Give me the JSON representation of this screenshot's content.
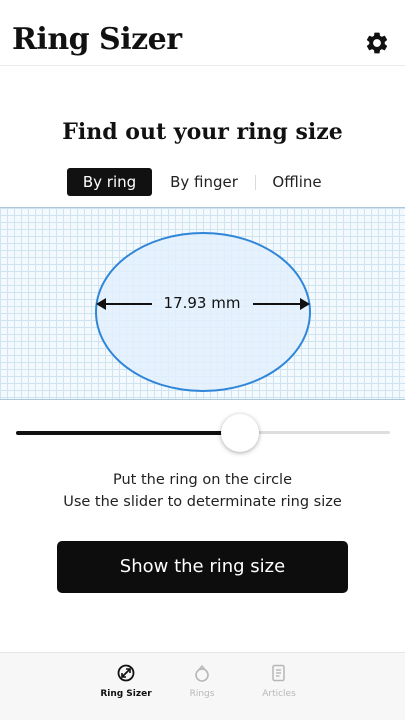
{
  "header": {
    "title": "Ring Sizer",
    "settings_icon": "gear-icon"
  },
  "main": {
    "headline": "Find out your ring size",
    "tabs": [
      {
        "label": "By ring",
        "active": true
      },
      {
        "label": "By finger",
        "active": false
      },
      {
        "label": "Offline",
        "active": false
      }
    ],
    "measurement": "17.93 mm",
    "slider_level": 0.6,
    "instructions": [
      "Put the ring on the circle",
      "Use the slider to determinate ring size"
    ],
    "cta_label": "Show the ring size"
  },
  "bottom_nav": {
    "items": [
      {
        "label": "Ring Sizer",
        "icon": "ring-measure-icon",
        "active": true
      },
      {
        "label": "Rings",
        "icon": "ring-icon",
        "active": false
      },
      {
        "label": "Articles",
        "icon": "article-icon",
        "active": false
      }
    ]
  },
  "colors": {
    "accent": "#2f86d8",
    "primary": "#111111",
    "grid_line": "#cfe4f1"
  }
}
